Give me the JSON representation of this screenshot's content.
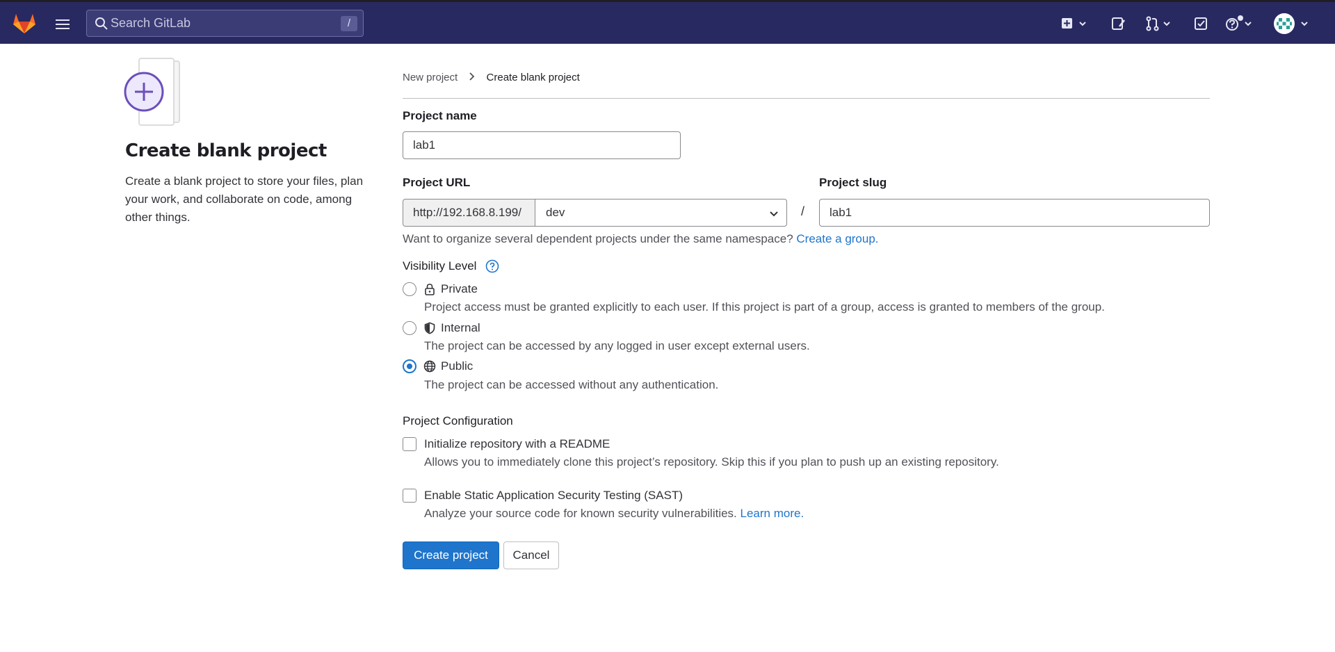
{
  "header": {
    "search_placeholder": "Search GitLab",
    "search_shortcut": "/",
    "icons": [
      "gitlab-logo-icon",
      "hamburger-menu-icon",
      "search-icon",
      "create-new-icon",
      "issues-icon",
      "merge-requests-icon",
      "todos-icon",
      "help-icon",
      "user-avatar"
    ]
  },
  "left_panel": {
    "title": "Create blank project",
    "description": "Create a blank project to store your files, plan your work, and collaborate on code, among other things."
  },
  "breadcrumb": {
    "parent": "New project",
    "current": "Create blank project"
  },
  "form": {
    "project_name_label": "Project name",
    "project_name_value": "lab1",
    "project_url_label": "Project URL",
    "url_prefix": "http://192.168.8.199/",
    "namespace_value": "dev",
    "url_separator": "/",
    "project_slug_label": "Project slug",
    "project_slug_value": "lab1",
    "namespace_help": "Want to organize several dependent projects under the same namespace?",
    "namespace_help_link": "Create a group."
  },
  "visibility": {
    "label": "Visibility Level",
    "selected": "Public",
    "options": [
      {
        "label": "Private",
        "icon": "lock-icon",
        "description": "Project access must be granted explicitly to each user. If this project is part of a group, access is granted to members of the group."
      },
      {
        "label": "Internal",
        "icon": "shield-icon",
        "description": "The project can be accessed by any logged in user except external users."
      },
      {
        "label": "Public",
        "icon": "globe-icon",
        "description": "The project can be accessed without any authentication."
      }
    ]
  },
  "configuration": {
    "label": "Project Configuration",
    "readme_label": "Initialize repository with a README",
    "readme_checked": false,
    "readme_description": "Allows you to immediately clone this project’s repository. Skip this if you plan to push up an existing repository.",
    "sast_label": "Enable Static Application Security Testing (SAST)",
    "sast_checked": false,
    "sast_description": "Analyze your source code for known security vulnerabilities.",
    "sast_link": "Learn more."
  },
  "actions": {
    "create_label": "Create project",
    "cancel_label": "Cancel"
  },
  "colors": {
    "header_bg": "#292961",
    "primary": "#1f75cb",
    "link": "#1f75cb",
    "logo_orange": "#fc6d26"
  }
}
